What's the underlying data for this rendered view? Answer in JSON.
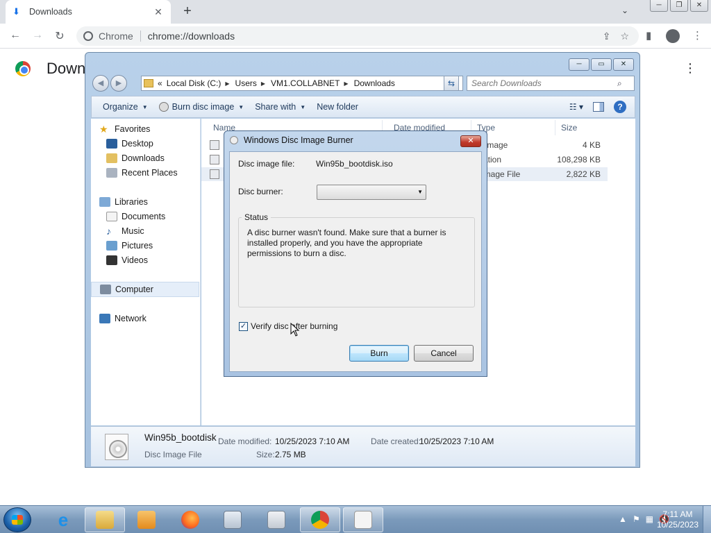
{
  "browser": {
    "tab_title": "Downloads",
    "omnibox_site": "Chrome",
    "omnibox_url": "chrome://downloads",
    "page_title": "Down"
  },
  "explorer": {
    "breadcrumb": [
      "«",
      "Local Disk (C:)",
      "Users",
      "VM1.COLLABNET",
      "Downloads"
    ],
    "search_placeholder": "Search Downloads",
    "commands": {
      "organize": "Organize",
      "burn": "Burn disc image",
      "share": "Share with",
      "new_folder": "New folder"
    },
    "nav": {
      "favorites": "Favorites",
      "desktop": "Desktop",
      "downloads": "Downloads",
      "recent": "Recent Places",
      "libraries": "Libraries",
      "documents": "Documents",
      "music": "Music",
      "pictures": "Pictures",
      "videos": "Videos",
      "computer": "Computer",
      "network": "Network"
    },
    "columns": {
      "name": "Name",
      "date": "Date modified",
      "type": "Type",
      "size": "Size"
    },
    "rows": [
      {
        "type": "EG image",
        "size": "4 KB"
      },
      {
        "type": "plication",
        "size": "108,298 KB"
      },
      {
        "type": "sc Image File",
        "size": "2,822 KB"
      }
    ],
    "details": {
      "name": "Win95b_bootdisk",
      "kind": "Disc Image File",
      "modified_label": "Date modified:",
      "modified_value": "10/25/2023 7:10 AM",
      "created_label": "Date created:",
      "created_value": "10/25/2023 7:10 AM",
      "size_label": "Size:",
      "size_value": "2.75 MB"
    }
  },
  "dialog": {
    "title": "Windows Disc Image Burner",
    "file_label": "Disc image file:",
    "file_value": "Win95b_bootdisk.iso",
    "burner_label": "Disc burner:",
    "burner_value": "",
    "status_label": "Status",
    "status_text": "A disc burner wasn't found. Make sure that a burner is installed properly, and you have the appropriate permissions to burn a disc.",
    "verify_label": "Verify disc after burning",
    "verify_checked": true,
    "burn_button": "Burn",
    "cancel_button": "Cancel"
  },
  "taskbar": {
    "time": "7:11 AM",
    "date": "10/25/2023"
  }
}
